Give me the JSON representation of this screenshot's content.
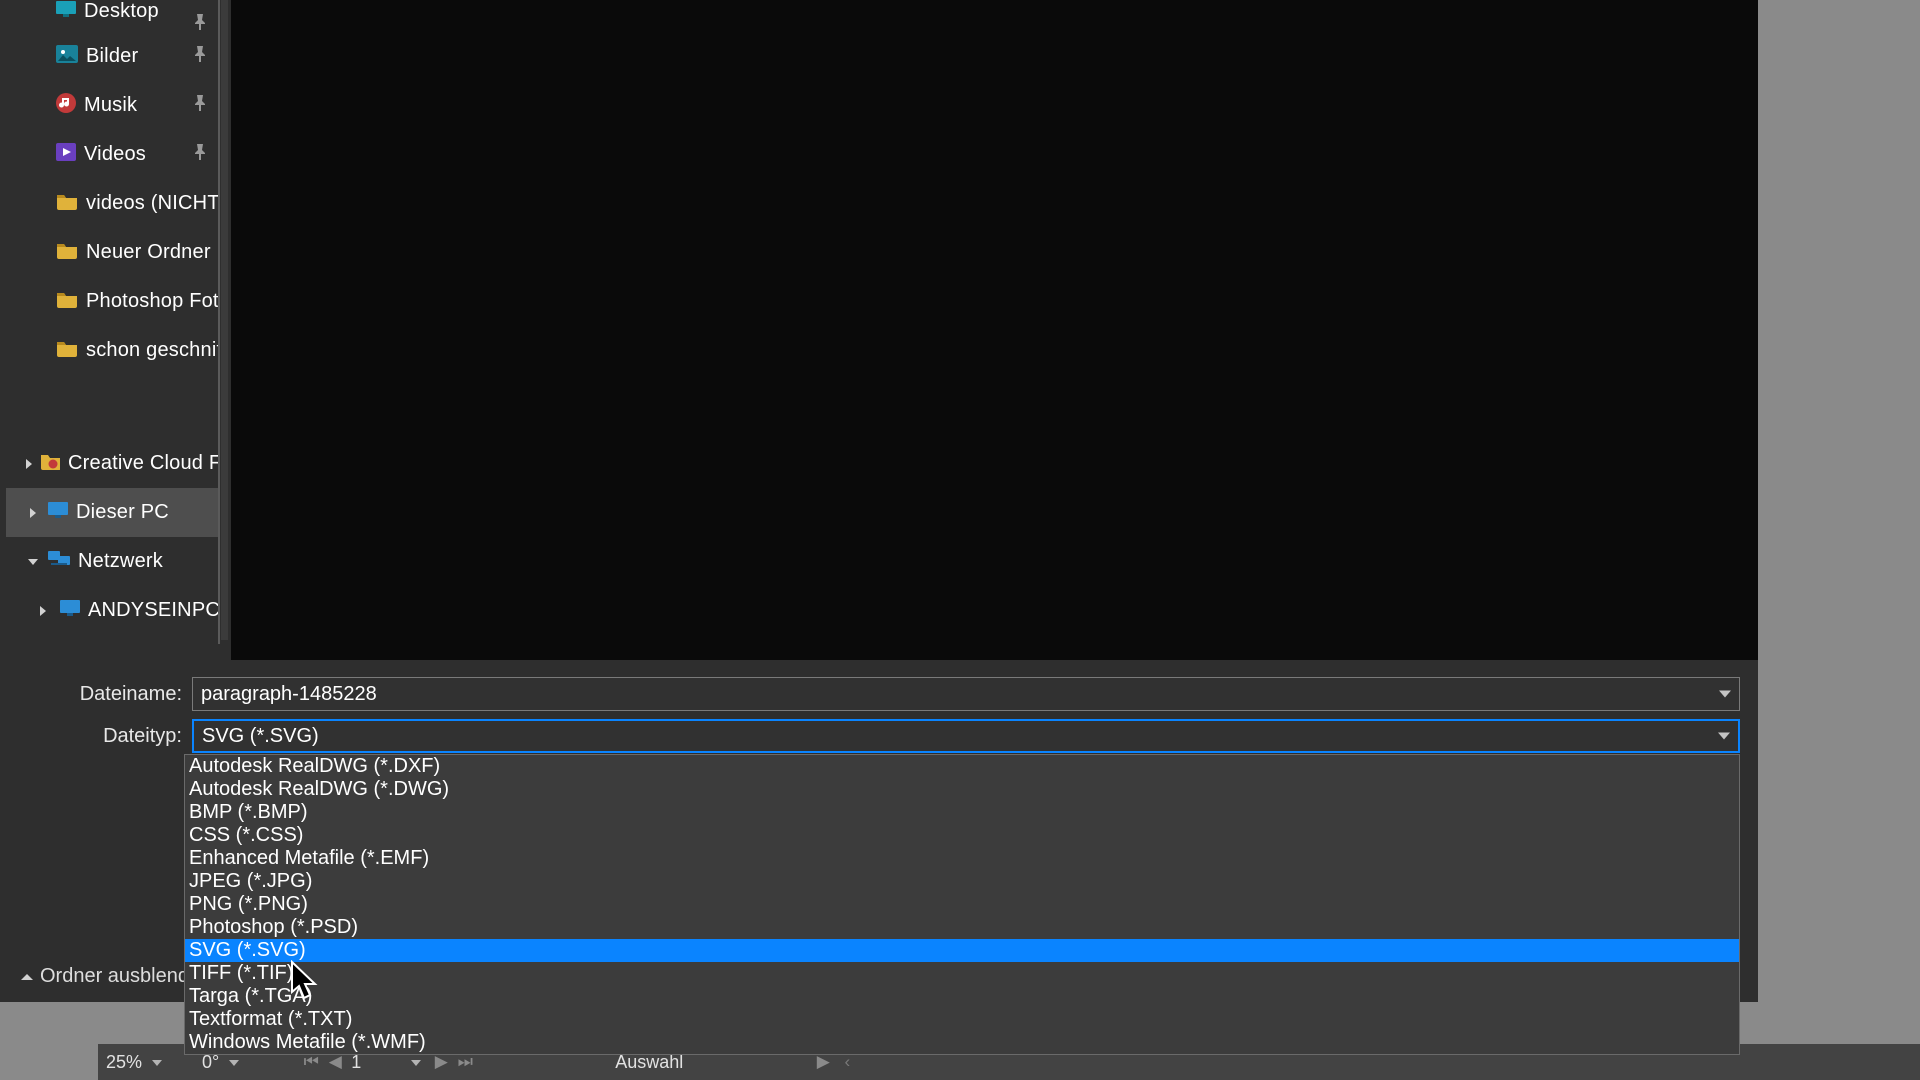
{
  "sidebar": {
    "items": [
      {
        "label": "Desktop",
        "icon": "monitor-teal",
        "pin": true
      },
      {
        "label": "Bilder",
        "icon": "photo-icon",
        "pin": true
      },
      {
        "label": "Musik",
        "icon": "music-icon",
        "pin": true
      },
      {
        "label": "Videos",
        "icon": "video-icon",
        "pin": true
      },
      {
        "label": "videos (NICHT F",
        "icon": "folder",
        "pin": false
      },
      {
        "label": "Neuer Ordner",
        "icon": "folder",
        "pin": false
      },
      {
        "label": "Photoshop Foto",
        "icon": "folder",
        "pin": false
      },
      {
        "label": "schon geschnitt",
        "icon": "folder",
        "pin": false
      }
    ],
    "tree": [
      {
        "label": "Creative Cloud F",
        "icon": "cc-icon",
        "expand": "right",
        "indent": 0
      },
      {
        "label": "Dieser PC",
        "icon": "monitor",
        "expand": "right",
        "indent": 0,
        "selected": true
      },
      {
        "label": "Netzwerk",
        "icon": "monitor-net",
        "expand": "down",
        "indent": 0
      },
      {
        "label": "ANDYSEINPC",
        "icon": "monitor",
        "expand": "right",
        "indent": 1
      }
    ]
  },
  "form": {
    "filename_label": "Dateiname:",
    "filename_value": "paragraph-1485228",
    "filetype_label": "Dateityp:",
    "filetype_value": "SVG (*.SVG)",
    "options": [
      "Autodesk RealDWG (*.DXF)",
      "Autodesk RealDWG (*.DWG)",
      "BMP (*.BMP)",
      "CSS (*.CSS)",
      "Enhanced Metafile (*.EMF)",
      "JPEG (*.JPG)",
      "PNG (*.PNG)",
      "Photoshop (*.PSD)",
      "SVG (*.SVG)",
      "TIFF (*.TIF)",
      "Targa (*.TGA)",
      "Textformat (*.TXT)",
      "Windows Metafile (*.WMF)"
    ],
    "highlighted_index": 8
  },
  "hide_folders_label": "Ordner ausblende",
  "statusbar": {
    "zoom": "25%",
    "angle": "0°",
    "page": "1",
    "selection_label": "Auswahl"
  }
}
